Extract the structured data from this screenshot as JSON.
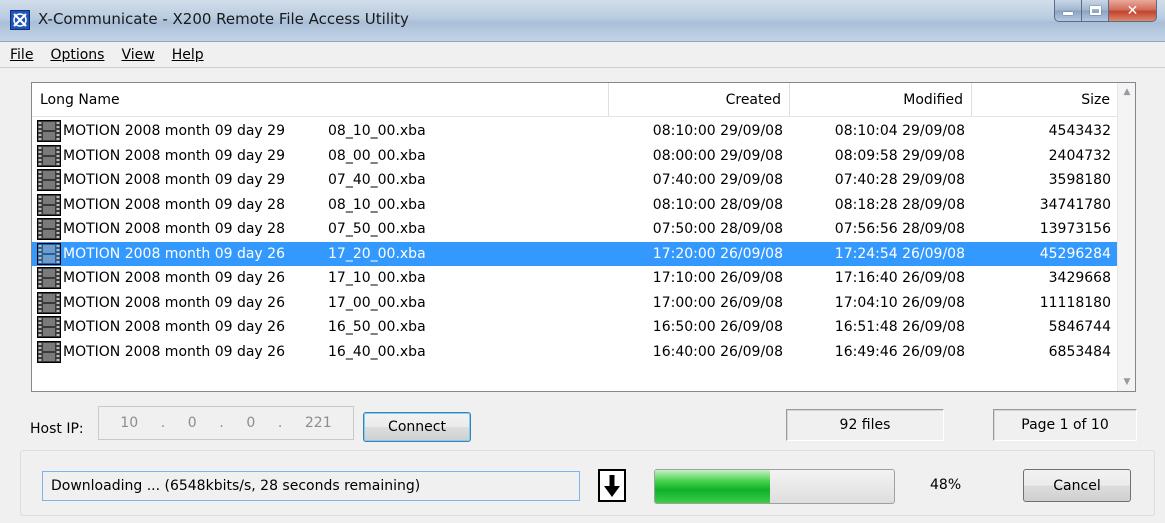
{
  "window": {
    "title": "X-Communicate - X200 Remote File Access Utility"
  },
  "menu": [
    {
      "label": "File"
    },
    {
      "label": "Options"
    },
    {
      "label": "View"
    },
    {
      "label": "Help"
    }
  ],
  "columns": {
    "name": "Long Name",
    "created": "Created",
    "modified": "Modified",
    "size": "Size"
  },
  "files": [
    {
      "name": "MOTION 2008 month 09 day 29",
      "time": "08_10_00.xba",
      "created": "08:10:00 29/09/08",
      "modified": "08:10:04 29/09/08",
      "size": "4543432",
      "selected": false
    },
    {
      "name": "MOTION 2008 month 09 day 29",
      "time": "08_00_00.xba",
      "created": "08:00:00 29/09/08",
      "modified": "08:09:58 29/09/08",
      "size": "2404732",
      "selected": false
    },
    {
      "name": "MOTION 2008 month 09 day 29",
      "time": "07_40_00.xba",
      "created": "07:40:00 29/09/08",
      "modified": "07:40:28 29/09/08",
      "size": "3598180",
      "selected": false
    },
    {
      "name": "MOTION 2008 month 09 day 28",
      "time": "08_10_00.xba",
      "created": "08:10:00 28/09/08",
      "modified": "08:18:28 28/09/08",
      "size": "34741780",
      "selected": false
    },
    {
      "name": "MOTION 2008 month 09 day 28",
      "time": "07_50_00.xba",
      "created": "07:50:00 28/09/08",
      "modified": "07:56:56 28/09/08",
      "size": "13973156",
      "selected": false
    },
    {
      "name": "MOTION 2008 month 09 day 26",
      "time": "17_20_00.xba",
      "created": "17:20:00 26/09/08",
      "modified": "17:24:54 26/09/08",
      "size": "45296284",
      "selected": true
    },
    {
      "name": "MOTION 2008 month 09 day 26",
      "time": "17_10_00.xba",
      "created": "17:10:00 26/09/08",
      "modified": "17:16:40 26/09/08",
      "size": "3429668",
      "selected": false
    },
    {
      "name": "MOTION 2008 month 09 day 26",
      "time": "17_00_00.xba",
      "created": "17:00:00 26/09/08",
      "modified": "17:04:10 26/09/08",
      "size": "11118180",
      "selected": false
    },
    {
      "name": "MOTION 2008 month 09 day 26",
      "time": "16_50_00.xba",
      "created": "16:50:00 26/09/08",
      "modified": "16:51:48 26/09/08",
      "size": "5846744",
      "selected": false
    },
    {
      "name": "MOTION 2008 month 09 day 26",
      "time": "16_40_00.xba",
      "created": "16:40:00 26/09/08",
      "modified": "16:49:46 26/09/08",
      "size": "6853484",
      "selected": false
    }
  ],
  "host": {
    "label": "Host IP:",
    "ip": [
      "10",
      "0",
      "0",
      "221"
    ],
    "connect_label": "Connect"
  },
  "status": {
    "file_count": "92 files",
    "page": "Page 1 of 10"
  },
  "download": {
    "status_text": "Downloading ...  (6548kbits/s,  28 seconds remaining)",
    "progress": 0.48,
    "percent_text": "48%",
    "cancel_label": "Cancel"
  },
  "colors": {
    "selection": "#3399ff",
    "progress_fill": "#1fbe36"
  }
}
